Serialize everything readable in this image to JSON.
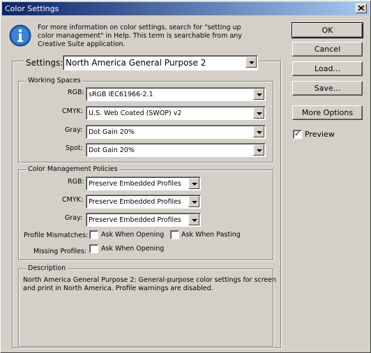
{
  "window": {
    "title": "Color Settings"
  },
  "info": {
    "line1": "For more information on color settings, search for \"setting up",
    "line2": "color management\" in Help. This term is searchable from any",
    "line3": "Creative Suite application."
  },
  "settings": {
    "label": "Settings:",
    "value": "North America General Purpose 2"
  },
  "working_spaces": {
    "title": "Working Spaces",
    "rgb_label": "RGB:",
    "rgb_value": "sRGB IEC61966-2.1",
    "cmyk_label": "CMYK:",
    "cmyk_value": "U.S. Web Coated (SWOP) v2",
    "gray_label": "Gray:",
    "gray_value": "Dot Gain 20%",
    "spot_label": "Spot:",
    "spot_value": "Dot Gain 20%"
  },
  "policies": {
    "title": "Color Management Policies",
    "rgb_label": "RGB:",
    "rgb_value": "Preserve Embedded Profiles",
    "cmyk_label": "CMYK:",
    "cmyk_value": "Preserve Embedded Profiles",
    "gray_label": "Gray:",
    "gray_value": "Preserve Embedded Profiles",
    "mismatch_label": "Profile Mismatches:",
    "ask_opening_label": "Ask When Opening",
    "ask_pasting_label": "Ask When Pasting",
    "missing_label": "Missing Profiles:",
    "missing_ask_opening_label": "Ask When Opening"
  },
  "description": {
    "title": "Description",
    "line1": "North America General Purpose 2:  General-purpose color settings for screen",
    "line2": "and print in North America. Profile warnings are disabled."
  },
  "buttons": {
    "ok": "OK",
    "cancel": "Cancel",
    "load": "Load...",
    "save": "Save...",
    "more_options": "More Options"
  },
  "preview": {
    "label": "Preview",
    "checked": true
  },
  "colors": {
    "titlebar_start": "#0a246a",
    "titlebar_end": "#a6caf0",
    "dialog_bg": "#d4d0c8"
  }
}
